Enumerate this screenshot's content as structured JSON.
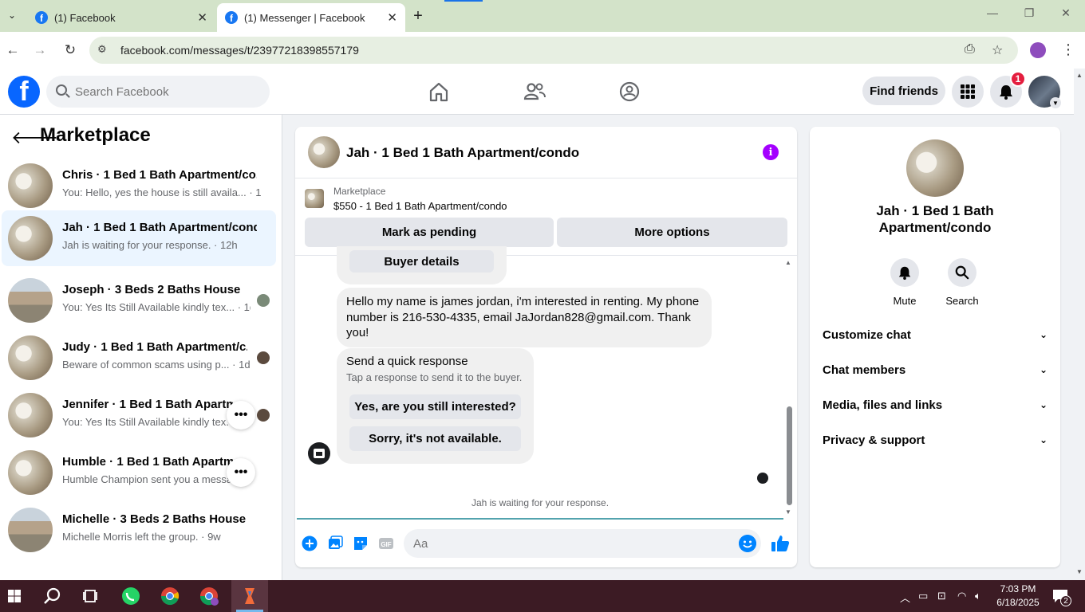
{
  "browser": {
    "tabs": [
      {
        "title": "(1) Facebook",
        "active": false
      },
      {
        "title": "(1) Messenger | Facebook",
        "active": true
      }
    ],
    "url": "facebook.com/messages/t/23977218398557179"
  },
  "fb_header": {
    "search_placeholder": "Search Facebook",
    "find_friends": "Find friends",
    "notification_count": "1"
  },
  "left_panel": {
    "title": "Marketplace",
    "conversations": [
      {
        "name": "Chris · 1 Bed 1 Bath Apartment/co...",
        "preview": "You: Hello, yes the house is still availa... · 1h",
        "thumb": "apt"
      },
      {
        "name": "Jah · 1 Bed 1 Bath Apartment/condo",
        "preview": "Jah is waiting for your response. · 12h",
        "thumb": "apt",
        "selected": true
      },
      {
        "name": "Joseph · 3 Beds 2 Baths House",
        "preview": "You: Yes Its Still Available kindly tex... · 1d",
        "thumb": "house"
      },
      {
        "name": "Judy · 1 Bed 1 Bath Apartment/c...",
        "preview": "Beware of common scams using p... · 1d",
        "thumb": "apt"
      },
      {
        "name": "Jennifer · 1 Bed 1 Bath Apartme",
        "preview": "You: Yes Its Still Available kindly tex...",
        "thumb": "apt"
      },
      {
        "name": "Humble · 1 Bed 1 Bath Apartme",
        "preview": "Humble Champion sent you a messa...w",
        "thumb": "apt"
      },
      {
        "name": "Michelle · 3 Beds 2 Baths House",
        "preview": "Michelle Morris left the group. · 9w",
        "thumb": "house"
      }
    ]
  },
  "chat": {
    "title": "Jah · 1 Bed 1 Bath Apartment/condo",
    "marketplace_label": "Marketplace",
    "listing": "$550 - 1 Bed 1 Bath Apartment/condo",
    "mark_pending": "Mark as pending",
    "more_options": "More options",
    "buyer_details": "Buyer details",
    "message": "Hello my name is james jordan, i'm interested in renting. My phone number is 216-530-4335, email JaJordan828@gmail.com. Thank you!",
    "quick_response_title": "Send a quick response",
    "quick_response_sub": "Tap a response to send it to the buyer.",
    "quick_replies": [
      "Yes, are you still interested?",
      "Sorry, it's not available."
    ],
    "waiting": "Jah is waiting for your response.",
    "compose_placeholder": "Aa"
  },
  "info_panel": {
    "name": "Jah · 1 Bed 1 Bath Apartment/condo",
    "actions": [
      "Mute",
      "Search"
    ],
    "sections": [
      "Customize chat",
      "Chat members",
      "Media, files and links",
      "Privacy & support"
    ]
  },
  "taskbar": {
    "time": "7:03 PM",
    "date": "6/18/2025",
    "notification_count": "2"
  },
  "colors": {
    "fb_blue": "#0866ff",
    "selected_bg": "#ebf5ff",
    "info_purple": "#a400ff",
    "taskbar": "#3c1b24"
  }
}
